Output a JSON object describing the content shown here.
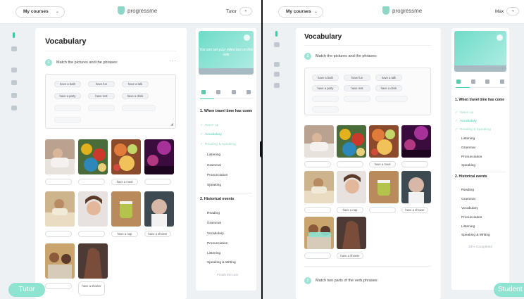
{
  "left_view": {
    "topbar": {
      "courses_label": "My courses",
      "brand": "progressme",
      "user_name": "Tutor"
    },
    "main": {
      "title": "Vocabulary",
      "task": {
        "number": "1",
        "text": "Match the pictures and the phrases:"
      },
      "phrases_active": [
        "have a bath",
        "have fun",
        "have a talk",
        "have a party",
        "have rest",
        "have a drink"
      ],
      "slot_labels": [
        "",
        "",
        "have a meal",
        "",
        "",
        "",
        "have a nap",
        "",
        "have a shower",
        "",
        "have a shower"
      ]
    },
    "sidebar": {
      "banner_text": "You can set your video box on this side",
      "sections": [
        {
          "title": "1. When travel time has come",
          "items": [
            {
              "label": "Warm up",
              "done": true
            },
            {
              "label": "Vocabulary",
              "done": true
            },
            {
              "label": "Reading & Speaking",
              "done": true
            },
            {
              "label": "Listening",
              "done": false
            },
            {
              "label": "Grammar",
              "done": false
            },
            {
              "label": "Pronunciation",
              "done": false
            },
            {
              "label": "Speaking",
              "done": false
            }
          ]
        },
        {
          "title": "2. Historical events",
          "items": [
            {
              "label": "Reading"
            },
            {
              "label": "Grammar"
            },
            {
              "label": "Vocabulary"
            },
            {
              "label": "Pronunciation"
            },
            {
              "label": "Listening"
            },
            {
              "label": "Speaking & Writing"
            }
          ]
        }
      ],
      "footer": "Finish the unit"
    },
    "role_badge": "Tutor"
  },
  "right_view": {
    "topbar": {
      "courses_label": "My courses",
      "brand": "progressme",
      "user_name": "Max"
    },
    "main": {
      "title": "Vocabulary",
      "task": {
        "number": "1",
        "text": "Match the pictures and the phrases:"
      },
      "phrases_active": [
        "have a bath",
        "have fun",
        "have a talk",
        "have a party",
        "have rest",
        "have a drink"
      ],
      "slot_labels": [
        "",
        "",
        "have a meal",
        "",
        "",
        "have a nap",
        "",
        "have a shower",
        "",
        "have a shower"
      ],
      "task2": {
        "number": "2",
        "text": "Match two parts of the verb phrases:"
      }
    },
    "sidebar": {
      "sections": [
        {
          "title": "1. When travel time has come",
          "items": [
            {
              "label": "Warm up",
              "done": true
            },
            {
              "label": "Vocabulary",
              "done": true
            },
            {
              "label": "Reading & Speaking",
              "done": true
            },
            {
              "label": "Listening",
              "done": false
            },
            {
              "label": "Grammar",
              "done": false
            },
            {
              "label": "Pronunciation",
              "done": false
            },
            {
              "label": "Speaking",
              "done": false
            }
          ]
        },
        {
          "title": "2. Historical events",
          "items": [
            {
              "label": "Reading"
            },
            {
              "label": "Grammar"
            },
            {
              "label": "Vocabulary"
            },
            {
              "label": "Pronunciation"
            },
            {
              "label": "Listening"
            },
            {
              "label": "Speaking & Writing"
            }
          ]
        }
      ],
      "footer": "33% Completed"
    },
    "role_badge": "Student"
  },
  "colors": {
    "accent": "#3cc9a8",
    "badge": "#8fe3d1",
    "divider": "#111111"
  }
}
